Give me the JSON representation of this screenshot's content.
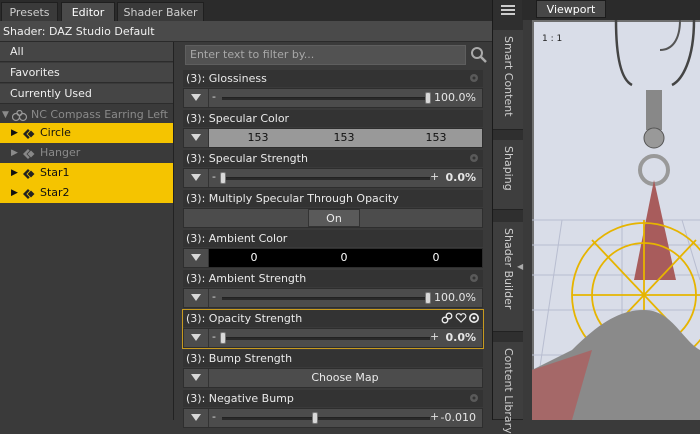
{
  "tabs": [
    "Presets",
    "Editor",
    "Shader Baker"
  ],
  "active_tab": "Editor",
  "shader_header": "Shader: DAZ Studio Default",
  "left_list": {
    "filters": [
      "All",
      "Favorites",
      "Currently Used"
    ],
    "root": "NC Compass Earring Left",
    "items": [
      {
        "label": "Circle",
        "selected": true
      },
      {
        "label": "Hanger",
        "selected": false
      },
      {
        "label": "Star1",
        "selected": true
      },
      {
        "label": "Star2",
        "selected": true
      }
    ]
  },
  "filter_placeholder": "Enter text to filter by...",
  "properties": [
    {
      "label": "(3): Glossiness",
      "kind": "slider",
      "value": "100.0%",
      "fill": 1.0
    },
    {
      "label": "(3): Specular Color",
      "kind": "color",
      "values": [
        "153",
        "153",
        "153"
      ],
      "color": "#999999"
    },
    {
      "label": "(3): Specular Strength",
      "kind": "slider-pm",
      "value": "0.0%",
      "fill": 0.0
    },
    {
      "label": "(3): Multiply Specular Through Opacity",
      "kind": "toggle",
      "value": "On"
    },
    {
      "label": "(3): Ambient Color",
      "kind": "color",
      "values": [
        "0",
        "0",
        "0"
      ],
      "color": "#000000"
    },
    {
      "label": "(3): Ambient Strength",
      "kind": "slider",
      "value": "100.0%",
      "fill": 1.0
    },
    {
      "label": "(3): Opacity Strength",
      "kind": "slider-pm",
      "value": "0.0%",
      "fill": 0.0
    },
    {
      "label": "(3): Bump Strength",
      "kind": "map",
      "value": "Choose Map"
    },
    {
      "label": "(3): Negative Bump",
      "kind": "slider",
      "value": "-0.010",
      "fill": 0.45
    }
  ],
  "side_tabs": [
    "Smart Content",
    "Shaping",
    "Shader Builder",
    "Content Library"
  ],
  "viewport": {
    "tab": "Viewport",
    "label": "1 : 1"
  },
  "colors": {
    "selection": "#f5c400",
    "highlight_border": "#c79a1f"
  }
}
